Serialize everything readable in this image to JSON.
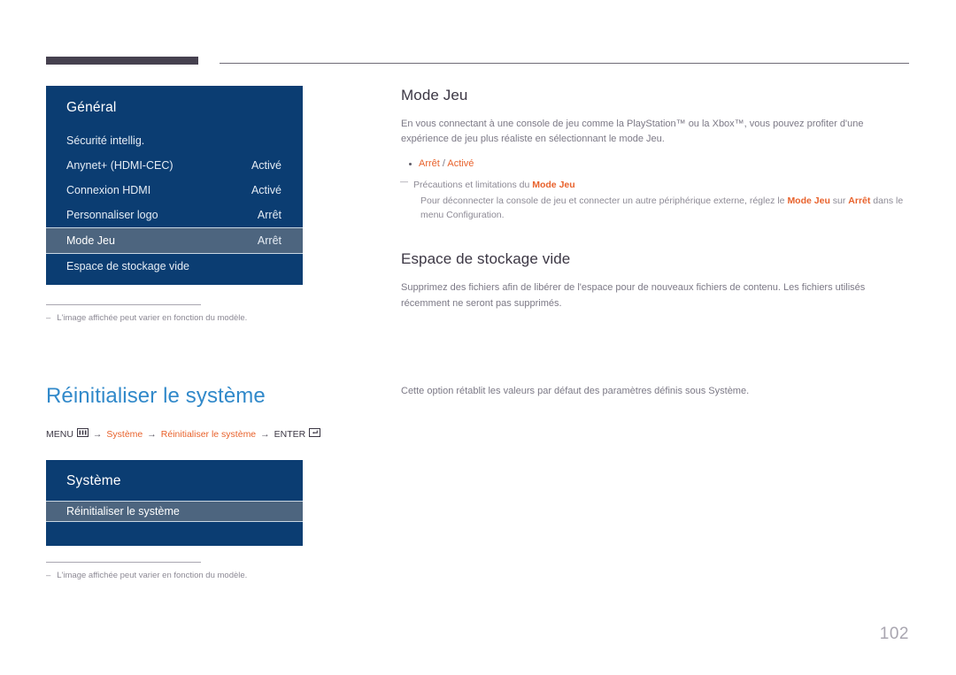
{
  "page": {
    "number": "102",
    "language": "fr"
  },
  "osd_general": {
    "title": "Général",
    "rows": [
      {
        "label": "Sécurité intellig.",
        "value": "",
        "selected": false
      },
      {
        "label": "Anynet+ (HDMI-CEC)",
        "value": "Activé",
        "selected": false
      },
      {
        "label": "Connexion HDMI",
        "value": "Activé",
        "selected": false
      },
      {
        "label": "Personnaliser logo",
        "value": "Arrêt",
        "selected": false
      },
      {
        "label": "Mode Jeu",
        "value": "Arrêt",
        "selected": true
      },
      {
        "label": "Espace de stockage vide",
        "value": "",
        "selected": false
      }
    ]
  },
  "osd_systeme": {
    "title": "Système",
    "rows": [
      {
        "label": "Réinitialiser le système",
        "value": "",
        "selected": true
      }
    ]
  },
  "notes": {
    "dash": "–",
    "image_varies": "L'image affichée peut varier en fonction du modèle."
  },
  "mode_jeu": {
    "title": "Mode Jeu",
    "paragraph": "En vous connectant à une console de jeu comme la PlayStation™ ou la Xbox™, vous pouvez profiter d'une expérience de jeu plus réaliste en sélectionnant le mode Jeu.",
    "options": {
      "first": "Arrêt",
      "separator": "/",
      "second": "Activé"
    },
    "caution": {
      "lead_text": "Précautions et limitations du ",
      "lead_highlight": "Mode Jeu",
      "body_1": "Pour déconnecter la console de jeu et connecter un autre périphérique externe, réglez le ",
      "body_hl_1": "Mode Jeu",
      "body_2": " sur ",
      "body_hl_2": "Arrêt",
      "body_3": " dans le menu Configuration."
    }
  },
  "espace_stockage": {
    "title": "Espace de stockage vide",
    "paragraph": "Supprimez des fichiers afin de libérer de l'espace pour de nouveaux fichiers de contenu. Les fichiers utilisés récemment ne seront pas supprimés."
  },
  "reinitialiser": {
    "title": "Réinitialiser le système",
    "breadcrumb": {
      "menu_label": "MENU",
      "menu_icon": "menu-grid-icon",
      "arrow": "→",
      "step_1": "Système",
      "step_2": "Réinitialiser le système",
      "enter_label": "ENTER",
      "enter_icon": "enter-key-icon"
    },
    "paragraph": "Cette option rétablit les valeurs par défaut des paramètres définis sous Système."
  },
  "colors": {
    "accent_orange": "#e8622c",
    "accent_blue": "#3189ca",
    "osd_blue": "#0b3d72",
    "osd_selected": "#4d657f",
    "header_bar": "#46414f"
  }
}
